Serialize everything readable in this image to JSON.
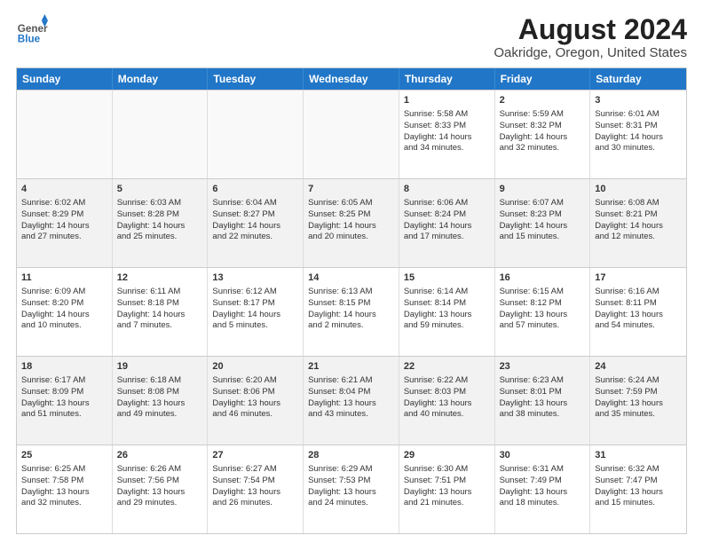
{
  "logo": {
    "general": "General",
    "blue": "Blue"
  },
  "title": "August 2024",
  "subtitle": "Oakridge, Oregon, United States",
  "days": [
    "Sunday",
    "Monday",
    "Tuesday",
    "Wednesday",
    "Thursday",
    "Friday",
    "Saturday"
  ],
  "weeks": [
    [
      {
        "num": "",
        "info": "",
        "empty": true
      },
      {
        "num": "",
        "info": "",
        "empty": true
      },
      {
        "num": "",
        "info": "",
        "empty": true
      },
      {
        "num": "",
        "info": "",
        "empty": true
      },
      {
        "num": "1",
        "info": "Sunrise: 5:58 AM\nSunset: 8:33 PM\nDaylight: 14 hours\nand 34 minutes.",
        "empty": false
      },
      {
        "num": "2",
        "info": "Sunrise: 5:59 AM\nSunset: 8:32 PM\nDaylight: 14 hours\nand 32 minutes.",
        "empty": false
      },
      {
        "num": "3",
        "info": "Sunrise: 6:01 AM\nSunset: 8:31 PM\nDaylight: 14 hours\nand 30 minutes.",
        "empty": false
      }
    ],
    [
      {
        "num": "4",
        "info": "Sunrise: 6:02 AM\nSunset: 8:29 PM\nDaylight: 14 hours\nand 27 minutes.",
        "empty": false
      },
      {
        "num": "5",
        "info": "Sunrise: 6:03 AM\nSunset: 8:28 PM\nDaylight: 14 hours\nand 25 minutes.",
        "empty": false
      },
      {
        "num": "6",
        "info": "Sunrise: 6:04 AM\nSunset: 8:27 PM\nDaylight: 14 hours\nand 22 minutes.",
        "empty": false
      },
      {
        "num": "7",
        "info": "Sunrise: 6:05 AM\nSunset: 8:25 PM\nDaylight: 14 hours\nand 20 minutes.",
        "empty": false
      },
      {
        "num": "8",
        "info": "Sunrise: 6:06 AM\nSunset: 8:24 PM\nDaylight: 14 hours\nand 17 minutes.",
        "empty": false
      },
      {
        "num": "9",
        "info": "Sunrise: 6:07 AM\nSunset: 8:23 PM\nDaylight: 14 hours\nand 15 minutes.",
        "empty": false
      },
      {
        "num": "10",
        "info": "Sunrise: 6:08 AM\nSunset: 8:21 PM\nDaylight: 14 hours\nand 12 minutes.",
        "empty": false
      }
    ],
    [
      {
        "num": "11",
        "info": "Sunrise: 6:09 AM\nSunset: 8:20 PM\nDaylight: 14 hours\nand 10 minutes.",
        "empty": false
      },
      {
        "num": "12",
        "info": "Sunrise: 6:11 AM\nSunset: 8:18 PM\nDaylight: 14 hours\nand 7 minutes.",
        "empty": false
      },
      {
        "num": "13",
        "info": "Sunrise: 6:12 AM\nSunset: 8:17 PM\nDaylight: 14 hours\nand 5 minutes.",
        "empty": false
      },
      {
        "num": "14",
        "info": "Sunrise: 6:13 AM\nSunset: 8:15 PM\nDaylight: 14 hours\nand 2 minutes.",
        "empty": false
      },
      {
        "num": "15",
        "info": "Sunrise: 6:14 AM\nSunset: 8:14 PM\nDaylight: 13 hours\nand 59 minutes.",
        "empty": false
      },
      {
        "num": "16",
        "info": "Sunrise: 6:15 AM\nSunset: 8:12 PM\nDaylight: 13 hours\nand 57 minutes.",
        "empty": false
      },
      {
        "num": "17",
        "info": "Sunrise: 6:16 AM\nSunset: 8:11 PM\nDaylight: 13 hours\nand 54 minutes.",
        "empty": false
      }
    ],
    [
      {
        "num": "18",
        "info": "Sunrise: 6:17 AM\nSunset: 8:09 PM\nDaylight: 13 hours\nand 51 minutes.",
        "empty": false
      },
      {
        "num": "19",
        "info": "Sunrise: 6:18 AM\nSunset: 8:08 PM\nDaylight: 13 hours\nand 49 minutes.",
        "empty": false
      },
      {
        "num": "20",
        "info": "Sunrise: 6:20 AM\nSunset: 8:06 PM\nDaylight: 13 hours\nand 46 minutes.",
        "empty": false
      },
      {
        "num": "21",
        "info": "Sunrise: 6:21 AM\nSunset: 8:04 PM\nDaylight: 13 hours\nand 43 minutes.",
        "empty": false
      },
      {
        "num": "22",
        "info": "Sunrise: 6:22 AM\nSunset: 8:03 PM\nDaylight: 13 hours\nand 40 minutes.",
        "empty": false
      },
      {
        "num": "23",
        "info": "Sunrise: 6:23 AM\nSunset: 8:01 PM\nDaylight: 13 hours\nand 38 minutes.",
        "empty": false
      },
      {
        "num": "24",
        "info": "Sunrise: 6:24 AM\nSunset: 7:59 PM\nDaylight: 13 hours\nand 35 minutes.",
        "empty": false
      }
    ],
    [
      {
        "num": "25",
        "info": "Sunrise: 6:25 AM\nSunset: 7:58 PM\nDaylight: 13 hours\nand 32 minutes.",
        "empty": false
      },
      {
        "num": "26",
        "info": "Sunrise: 6:26 AM\nSunset: 7:56 PM\nDaylight: 13 hours\nand 29 minutes.",
        "empty": false
      },
      {
        "num": "27",
        "info": "Sunrise: 6:27 AM\nSunset: 7:54 PM\nDaylight: 13 hours\nand 26 minutes.",
        "empty": false
      },
      {
        "num": "28",
        "info": "Sunrise: 6:29 AM\nSunset: 7:53 PM\nDaylight: 13 hours\nand 24 minutes.",
        "empty": false
      },
      {
        "num": "29",
        "info": "Sunrise: 6:30 AM\nSunset: 7:51 PM\nDaylight: 13 hours\nand 21 minutes.",
        "empty": false
      },
      {
        "num": "30",
        "info": "Sunrise: 6:31 AM\nSunset: 7:49 PM\nDaylight: 13 hours\nand 18 minutes.",
        "empty": false
      },
      {
        "num": "31",
        "info": "Sunrise: 6:32 AM\nSunset: 7:47 PM\nDaylight: 13 hours\nand 15 minutes.",
        "empty": false
      }
    ]
  ]
}
